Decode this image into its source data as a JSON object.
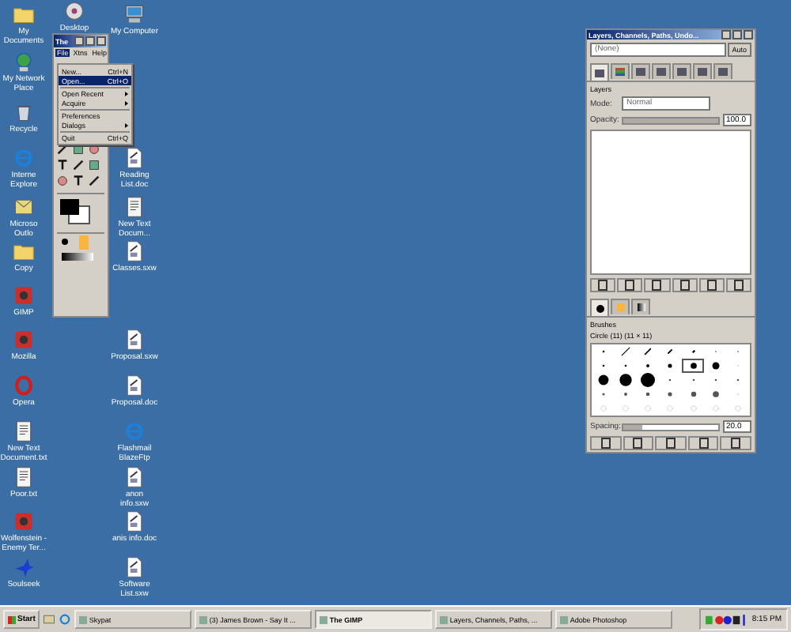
{
  "desktop_icons": [
    {
      "label": "My Documents",
      "kind": "folder"
    },
    {
      "label": "Desktop",
      "kind": "disc"
    },
    {
      "label": "My Computer",
      "kind": "computer"
    },
    {
      "label": "My Network Place",
      "kind": "globe"
    },
    {
      "label": "Recycle",
      "kind": "bin"
    },
    {
      "label": "Interne Explore",
      "kind": "ie"
    },
    {
      "label": "Reading List.doc",
      "kind": "doc"
    },
    {
      "label": "Microso Outlo",
      "kind": "mail"
    },
    {
      "label": "New Text Docum...",
      "kind": "text"
    },
    {
      "label": "Copy",
      "kind": "folder"
    },
    {
      "label": "Classes.sxw",
      "kind": "doc"
    },
    {
      "label": "GIMP",
      "kind": "app"
    },
    {
      "label": "Mozilla",
      "kind": "app"
    },
    {
      "label": "Proposal.sxw",
      "kind": "doc"
    },
    {
      "label": "Opera",
      "kind": "opera"
    },
    {
      "label": "Proposal.doc",
      "kind": "doc"
    },
    {
      "label": "New Text Document.txt",
      "kind": "text"
    },
    {
      "label": "Flashmail BlazeFtp",
      "kind": "ie"
    },
    {
      "label": "Poor.txt",
      "kind": "text"
    },
    {
      "label": "anon info.sxw",
      "kind": "doc"
    },
    {
      "label": "Wolfenstein - Enemy Ter...",
      "kind": "app"
    },
    {
      "label": "anis info.doc",
      "kind": "doc"
    },
    {
      "label": "Soulseek",
      "kind": "bird"
    },
    {
      "label": "Software List.sxw",
      "kind": "doc"
    }
  ],
  "toolbox": {
    "title": "The",
    "menubar": [
      {
        "label": "File",
        "selected": true
      },
      {
        "label": "Xtns",
        "selected": false
      },
      {
        "label": "Help",
        "selected": false
      }
    ]
  },
  "file_menu": [
    {
      "kind": "item",
      "label": "New...",
      "shortcut": "Ctrl+N",
      "submenu": false,
      "selected": false
    },
    {
      "kind": "item",
      "label": "Open...",
      "shortcut": "Ctrl+O",
      "submenu": false,
      "selected": true
    },
    {
      "kind": "separator"
    },
    {
      "kind": "item",
      "label": "Open Recent",
      "submenu": true,
      "selected": false
    },
    {
      "kind": "item",
      "label": "Acquire",
      "submenu": true,
      "selected": false
    },
    {
      "kind": "separator"
    },
    {
      "kind": "item",
      "label": "Preferences",
      "submenu": false,
      "selected": false
    },
    {
      "kind": "item",
      "label": "Dialogs",
      "submenu": true,
      "selected": false
    },
    {
      "kind": "separator"
    },
    {
      "kind": "item",
      "label": "Quit",
      "shortcut": "Ctrl+Q",
      "submenu": false,
      "selected": false
    }
  ],
  "dock": {
    "title": "Layers, Channels, Paths, Undo...",
    "image_menu": "(None)",
    "auto_button": "Auto",
    "tabs": [
      {
        "selected": true
      },
      {
        "selected": false
      },
      {
        "selected": false
      },
      {
        "selected": false
      },
      {
        "selected": false
      },
      {
        "selected": false
      },
      {
        "selected": false
      }
    ],
    "layers": {
      "heading": "Layers",
      "mode_label": "Mode:",
      "mode": "Normal",
      "opacity_label": "Opacity:",
      "opacity": "100.0",
      "level": 1.0
    },
    "color_tabs": [
      {
        "selected": true
      },
      {
        "selected": false
      },
      {
        "selected": false
      }
    ],
    "brushes": {
      "heading": "Brushes",
      "name": "Circle (11) (11 × 11)",
      "spacing_label": "Spacing:",
      "spacing": "20.0",
      "level": 0.2,
      "items": [
        {
          "selected": false
        },
        {
          "selected": false
        },
        {
          "selected": false
        },
        {
          "selected": false
        },
        {
          "selected": false
        },
        {
          "selected": false
        },
        {
          "selected": false
        },
        {
          "selected": false
        },
        {
          "selected": false
        },
        {
          "selected": false
        },
        {
          "selected": false
        },
        {
          "selected": true
        },
        {
          "selected": false
        },
        {
          "selected": false
        },
        {
          "selected": false
        },
        {
          "selected": false
        },
        {
          "selected": false
        },
        {
          "selected": false
        },
        {
          "selected": false
        },
        {
          "selected": false
        },
        {
          "selected": false
        },
        {
          "selected": false
        },
        {
          "selected": false
        },
        {
          "selected": false
        },
        {
          "selected": false
        },
        {
          "selected": false
        },
        {
          "selected": false
        },
        {
          "selected": false
        },
        {
          "selected": false
        },
        {
          "selected": false
        },
        {
          "selected": false
        },
        {
          "selected": false
        },
        {
          "selected": false
        },
        {
          "selected": false
        },
        {
          "selected": false
        }
      ]
    }
  },
  "taskbar": {
    "start": "Start",
    "buttons": [
      {
        "label": "Skypat",
        "selected": false
      },
      {
        "label": "(3) James Brown - Say It ...",
        "selected": false
      },
      {
        "label": "The GIMP",
        "selected": true
      },
      {
        "label": "Layers, Channels, Paths, ...",
        "selected": false
      },
      {
        "label": "Adobe Photoshop",
        "selected": false
      }
    ],
    "clock": "8:15 PM"
  }
}
